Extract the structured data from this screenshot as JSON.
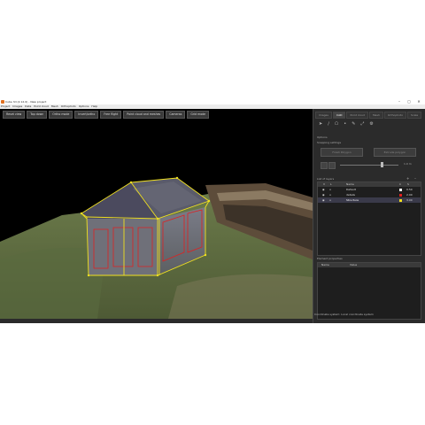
{
  "window": {
    "title": "Cube 3d (2.12.0) - New project",
    "controls": [
      "–",
      "▢",
      "✕"
    ]
  },
  "menu": [
    "Project",
    "Images",
    "Data",
    "Point cloud",
    "Mesh",
    "Orthophoto",
    "Options",
    "Help"
  ],
  "viewport": {
    "toolbar": [
      "Reset view",
      "Top down",
      "Ortho mode",
      "Invert/ortho",
      "Free flight",
      "Point cloud and meshes",
      "Cameras",
      "Grid mode"
    ]
  },
  "panel": {
    "tabs": [
      {
        "label": "Images",
        "active": false
      },
      {
        "label": "CAD",
        "active": true
      },
      {
        "label": "Point cloud",
        "active": false
      },
      {
        "label": "Mesh",
        "active": false
      },
      {
        "label": "Orthophoto",
        "active": false
      },
      {
        "label": "Scale",
        "active": false
      }
    ],
    "options_label": "Options",
    "snap_label": "Snapping settings",
    "btn_left": "Finish Polygon",
    "btn_right": "Extrude polygon",
    "slider_value": "1.0 m",
    "layers_label": "List of layers",
    "layers_columns": {
      "visible": "V",
      "lock": "L",
      "name": "Name",
      "color": "C",
      "size": "S"
    },
    "layers": [
      {
        "name": "Default",
        "color": "#ffffff",
        "size": "0.50"
      },
      {
        "name": "details",
        "color": "#e02020",
        "size": "2.00"
      },
      {
        "name": "Structure",
        "color": "#f0e020",
        "size": "3.00"
      }
    ],
    "props_label": "Element properties",
    "props_columns": {
      "name": "Name",
      "value": "Value"
    },
    "status": "Coordinate system: Local coordinate system"
  }
}
